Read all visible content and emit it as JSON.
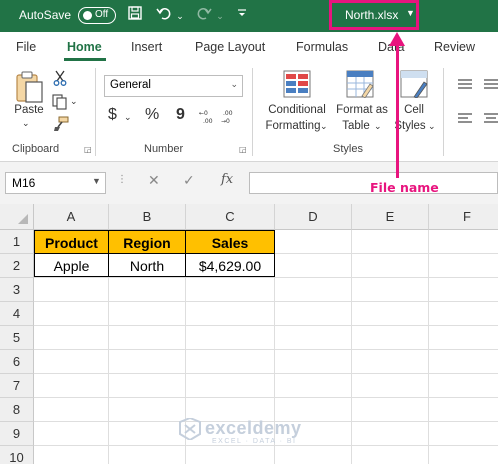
{
  "titlebar": {
    "autosave_label": "AutoSave",
    "autosave_state": "Off",
    "filename": "North.xlsx",
    "bg_color": "#217346"
  },
  "tabs": [
    "File",
    "Home",
    "Insert",
    "Page Layout",
    "Formulas",
    "Data",
    "Review"
  ],
  "active_tab": "Home",
  "ribbon": {
    "clipboard": {
      "paste_label": "Paste",
      "group_label": "Clipboard"
    },
    "number": {
      "format_value": "General",
      "currency": "$",
      "percent": "%",
      "comma": "9",
      "group_label": "Number"
    },
    "styles": {
      "conditional_formatting_l1": "Conditional",
      "conditional_formatting_l2": "Formatting",
      "format_as_table_l1": "Format as",
      "format_as_table_l2": "Table",
      "cell_styles_l1": "Cell",
      "cell_styles_l2": "Styles",
      "group_label": "Styles"
    }
  },
  "formula_bar": {
    "name_box": "M16",
    "fx": "fx",
    "value": ""
  },
  "annotation": {
    "text": "File name",
    "color": "#e8147e"
  },
  "sheet": {
    "columns": [
      "A",
      "B",
      "C",
      "D",
      "E",
      "F"
    ],
    "rows": [
      "1",
      "2",
      "3",
      "4",
      "5",
      "6",
      "7",
      "8",
      "9",
      "10"
    ],
    "headers": [
      "Product",
      "Region",
      "Sales"
    ],
    "data_row": [
      "Apple",
      "North",
      "$4,629.00"
    ],
    "header_fill": "#ffc000"
  },
  "watermark": {
    "name": "exceldemy",
    "tagline": "EXCEL · DATA · BI"
  }
}
